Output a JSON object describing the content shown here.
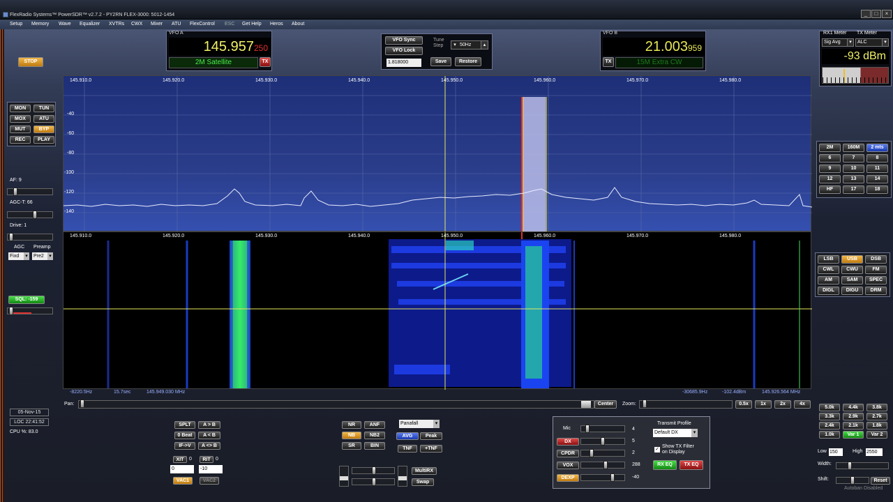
{
  "window": {
    "title": "FlexRadio Systems™ PowerSDR™ v2.7.2  -  PY2RN  FLEX-3000: 5012-1454"
  },
  "menu": [
    "Setup",
    "Memory",
    "Wave",
    "Equalizer",
    "XVTRs",
    "CWX",
    "Mixer",
    "ATU",
    "FlexControl",
    "ESC",
    "Get Help",
    "Heros",
    "About"
  ],
  "stop_label": "STOP",
  "vfoa": {
    "label": "VFO A",
    "freq": "145.957",
    "freq_small": "250",
    "band": "2M Satellite",
    "tx": "TX"
  },
  "vfob": {
    "label": "VFO B",
    "freq": "21.003",
    "freq_small": "959",
    "band": "15M Extra CW",
    "tx": "TX"
  },
  "center": {
    "sync": "VFO Sync",
    "lock": "VFO Lock",
    "tune_step_label": "Tune Step",
    "tune_step": "50Hz",
    "lo_value": "1.818000",
    "save": "Save",
    "restore": "Restore"
  },
  "meter": {
    "rx_label": "RX1 Meter",
    "tx_label": "TX Meter",
    "rx_sel": "Sig Avg",
    "tx_sel": "ALC",
    "reading": "-93 dBm"
  },
  "left_buttons": [
    "MON",
    "TUN",
    "MOX",
    "ATU",
    "MUT",
    "BYP",
    "REC",
    "PLAY"
  ],
  "left": {
    "af": "AF:  9",
    "agct": "AGC-T:  66",
    "drive": "Drive:  1",
    "agc": "AGC",
    "preamp": "Preamp",
    "agc_val": "Fixd",
    "preamp_val": "Pre2",
    "sql": "SQL: -159"
  },
  "pano_scale": [
    "-40",
    "-60",
    "-80",
    "-100",
    "-120",
    "-140"
  ],
  "freq_scale": [
    "145.910.0",
    "145.920.0",
    "145.930.0",
    "145.940.0",
    "145.950.0",
    "145.960.0",
    "145.970.0",
    "145.980.0"
  ],
  "status": {
    "offset": "-8220.5Hz",
    "time": "15.7sec",
    "freq": "145.949.030 MHz",
    "right_offset": "-30685.9Hz",
    "right_dbm": "-102.4dBm",
    "right_freq": "145.926.564 MHz"
  },
  "pan": {
    "label": "Pan:",
    "center": "Center",
    "zoom": "Zoom:",
    "zooms": [
      "0.5x",
      "1x",
      "2x",
      "4x"
    ]
  },
  "clock": {
    "date": "05-Nov-15",
    "loc": "LOC 22:41:52",
    "cpu": "CPU %:  83.0"
  },
  "band_buttons": [
    "2M",
    "160M",
    "2 mts",
    "6",
    "7",
    "8",
    "9",
    "10",
    "11",
    "12",
    "13",
    "14",
    "HF",
    "17",
    "18"
  ],
  "modes": [
    "LSB",
    "USB",
    "DSB",
    "CWL",
    "CWU",
    "FM",
    "AM",
    "SAM",
    "SPEC",
    "DIGL",
    "DIGU",
    "DRM"
  ],
  "filters": [
    "5.0k",
    "4.4k",
    "3.8k",
    "3.3k",
    "2.9k",
    "2.7k",
    "2.4k",
    "2.1k",
    "1.8k",
    "1.0k",
    "Var 1",
    "Var 2"
  ],
  "filter": {
    "low_label": "Low",
    "low": "150",
    "high_label": "High",
    "high": "2550",
    "width": "Width:",
    "shift": "Shift:",
    "reset": "Reset"
  },
  "split": {
    "split": "SPLT",
    "ab": "A > B",
    "zerobeat": "0 Beat",
    "ba": "A < B",
    "iftov": "IF->V",
    "swap": "A <> B",
    "xit": "XIT",
    "xit_val": "0",
    "rit": "RIT",
    "rit_val": "0",
    "xit_input": "0",
    "rit_input": "-10",
    "vac1": "VAC1",
    "vac2": "VAC2"
  },
  "dsp": {
    "nr": "NR",
    "anf": "ANF",
    "nb": "NB",
    "nb2": "NB2",
    "sr": "SR",
    "bin": "BIN",
    "display": "Panafall",
    "avg": "AVG",
    "peak": "Peak",
    "tnf": "TNF",
    "tnf_plus": "+TNF",
    "multirx": "MultiRX",
    "swap": "Swap"
  },
  "tx": {
    "mic": "Mic",
    "mic_val": "4",
    "dx": "DX",
    "dx_val": "5",
    "cpdr": "CPDR",
    "cpdr_val": "2",
    "vox": "VOX",
    "vox_val": "288",
    "dexp": "DEXP",
    "dexp_val": "-40",
    "profile_label": "Transmit Profile",
    "profile": "Default DX",
    "show_filter": "Show TX Filter on Display",
    "rx_eq": "RX EQ",
    "tx_eq": "TX EQ"
  },
  "autoban": "Autoban Disabled"
}
